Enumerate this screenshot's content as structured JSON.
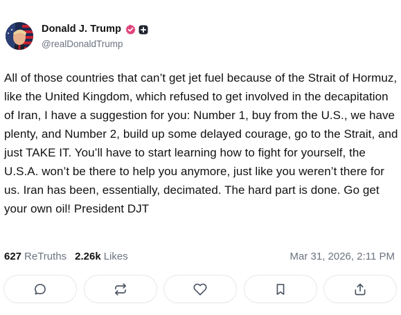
{
  "author": {
    "display_name": "Donald J. Trump",
    "handle": "@realDonaldTrump",
    "avatar_icon": "avatar-portrait-flag",
    "verified_icon": "verified-badge-icon",
    "verified_color": "#e0457b",
    "plus_icon": "plus-badge-icon"
  },
  "post": {
    "text": "All of those countries that can’t get jet fuel because of the Strait of Hormuz, like the United Kingdom, which refused to get involved in the decapitation of Iran, I have a suggestion for you: Number 1, buy from the U.S., we have plenty, and Number 2, build up some delayed courage, go to the Strait, and just TAKE IT. You’ll have to start learning how to fight for yourself, the U.S.A. won’t be there to help you anymore, just like you weren’t there for us. Iran has been, essentially, decimated. The hard part is done. Go get your own oil! President DJT"
  },
  "stats": {
    "retruths_count": "627",
    "retruths_label": "ReTruths",
    "likes_count": "2.26k",
    "likes_label": "Likes",
    "timestamp": "Mar 31, 2026, 2:11 PM"
  },
  "actions": [
    {
      "name": "reply",
      "icon": "comment-icon"
    },
    {
      "name": "retruth",
      "icon": "repost-icon"
    },
    {
      "name": "like",
      "icon": "heart-icon"
    },
    {
      "name": "bookmark",
      "icon": "bookmark-icon"
    },
    {
      "name": "share",
      "icon": "share-icon"
    }
  ],
  "colors": {
    "text": "#111111",
    "muted": "#6b7280",
    "border": "#e5e7eb",
    "icon": "#4b5563"
  }
}
